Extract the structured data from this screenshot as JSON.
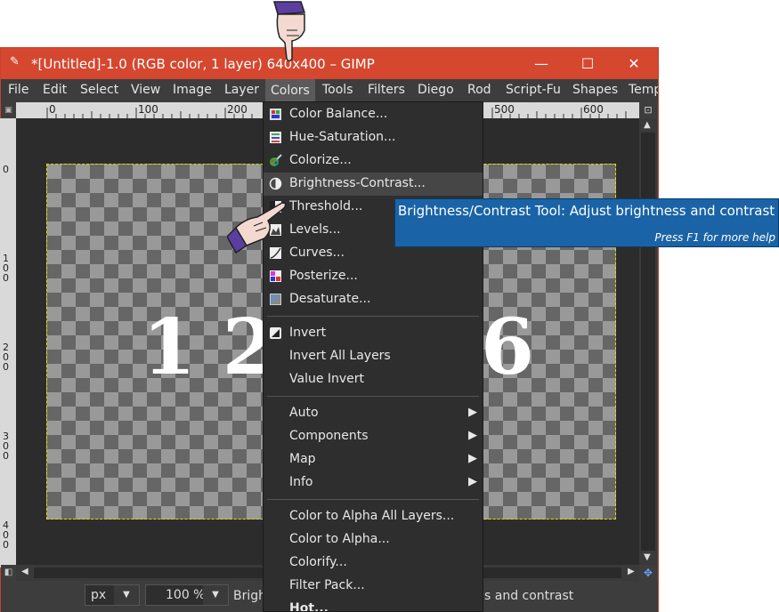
{
  "window": {
    "title": "*[Untitled]-1.0 (RGB color, 1 layer) 640x400 – GIMP",
    "minimize": "—",
    "maximize": "☐",
    "close": "✕"
  },
  "menubar": [
    "File",
    "Edit",
    "Select",
    "View",
    "Image",
    "Layer",
    "Colors",
    "Tools",
    "Filters",
    "Diego",
    "Rod",
    "Script-Fu",
    "Shapes",
    "Temp"
  ],
  "ruler": {
    "h_labels": [
      "0",
      "100",
      "200",
      "500",
      "600"
    ],
    "v_labels": [
      "0",
      "100",
      "200",
      "300",
      "400"
    ]
  },
  "canvas_text": {
    "left": "1 2",
    "right": "6"
  },
  "colors_menu": {
    "items": [
      {
        "label": "Color Balance...",
        "icon": "color-balance-icon"
      },
      {
        "label": "Hue-Saturation...",
        "icon": "hue-saturation-icon"
      },
      {
        "label": "Colorize...",
        "icon": "colorize-icon"
      },
      {
        "label": "Brightness-Contrast...",
        "icon": "brightness-contrast-icon"
      },
      {
        "label": "Threshold...",
        "icon": "threshold-icon"
      },
      {
        "label": "Levels...",
        "icon": "levels-icon"
      },
      {
        "label": "Curves...",
        "icon": "curves-icon"
      },
      {
        "label": "Posterize...",
        "icon": "posterize-icon"
      },
      {
        "label": "Desaturate...",
        "icon": "desaturate-icon"
      },
      {
        "label": "Invert",
        "icon": "invert-icon"
      },
      {
        "label": "Invert All Layers"
      },
      {
        "label": "Value Invert"
      },
      {
        "label": "Auto"
      },
      {
        "label": "Components"
      },
      {
        "label": "Map"
      },
      {
        "label": "Info"
      },
      {
        "label": "Color to Alpha All Layers..."
      },
      {
        "label": "Color to Alpha..."
      },
      {
        "label": "Colorify..."
      },
      {
        "label": "Filter Pack..."
      },
      {
        "label": "Hot..."
      }
    ]
  },
  "tooltip": {
    "title": "Brightness/Contrast Tool: Adjust brightness and contrast",
    "hint": "Press F1 for more help"
  },
  "statusbar": {
    "unit": "px",
    "zoom": "100 %",
    "message_left": "Brigh",
    "message_right": "s and contrast"
  }
}
